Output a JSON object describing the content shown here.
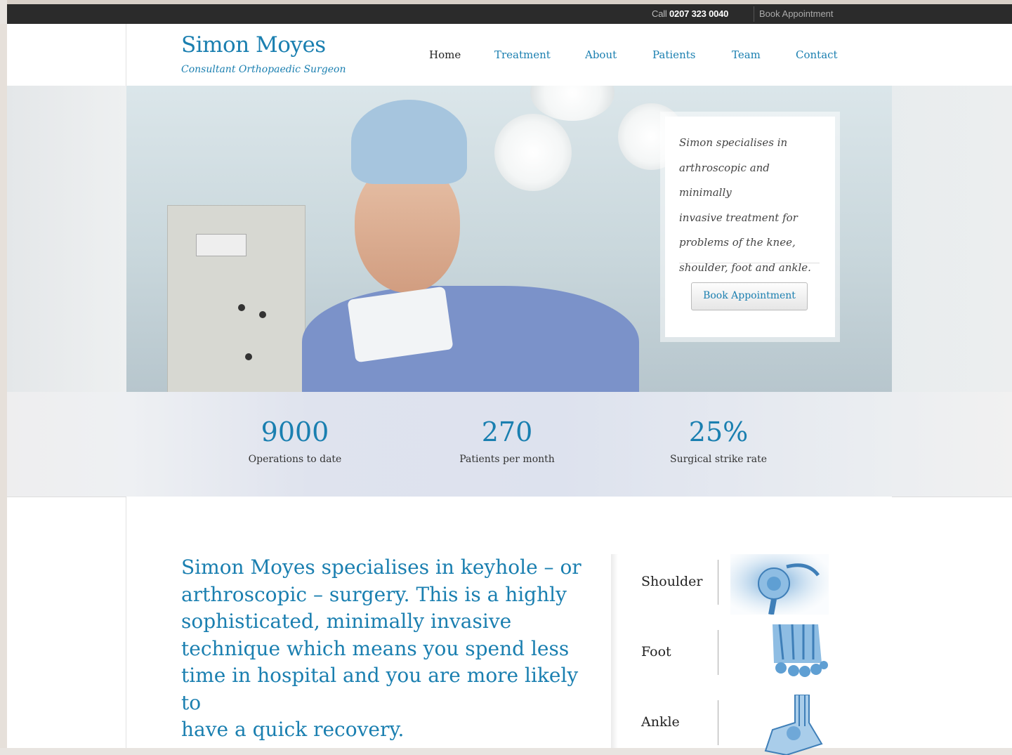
{
  "topbar": {
    "call_prefix": "Call",
    "phone": "0207 323 0040",
    "book_label": "Book Appointment"
  },
  "header": {
    "logo_title": "Simon Moyes",
    "logo_subtitle": "Consultant Orthopaedic Surgeon",
    "nav": [
      {
        "label": "Home",
        "active": true
      },
      {
        "label": "Treatment",
        "active": false
      },
      {
        "label": "About",
        "active": false
      },
      {
        "label": "Patients",
        "active": false
      },
      {
        "label": "Team",
        "active": false
      },
      {
        "label": "Contact",
        "active": false
      }
    ]
  },
  "hero": {
    "card_lines": [
      "Simon specialises in",
      "arthroscopic and minimally",
      "invasive treatment for",
      "problems of the knee,",
      "shoulder, foot and ankle."
    ],
    "card_button": "Book Appointment"
  },
  "stats": [
    {
      "value": "9000",
      "label": "Operations to date"
    },
    {
      "value": "270",
      "label": "Patients per month"
    },
    {
      "value": "25%",
      "label": "Surgical strike rate"
    }
  ],
  "content": {
    "intro_lines": [
      "Simon Moyes specialises in keyhole – or",
      "arthroscopic – surgery. This is a highly",
      "sophisticated, minimally invasive",
      "technique which means you spend less",
      "time in hospital and you are more likely to",
      "have a quick recovery."
    ],
    "areas": [
      {
        "name": "Shoulder",
        "icon": "shoulder-xray-icon"
      },
      {
        "name": "Foot",
        "icon": "foot-xray-icon"
      },
      {
        "name": "Ankle",
        "icon": "ankle-xray-icon"
      }
    ]
  },
  "colors": {
    "accent": "#1a7fb0",
    "topbar": "#2b2b2b",
    "text": "#222222"
  }
}
